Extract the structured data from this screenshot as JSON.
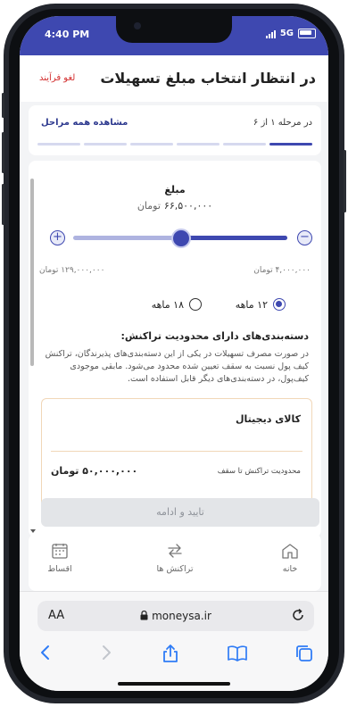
{
  "status_bar": {
    "time": "4:40 PM",
    "network": "5G"
  },
  "header": {
    "title": "در انتظار انتخاب مبلغ تسهیلات",
    "cancel_label": "لغو فرآیند"
  },
  "steps": {
    "current_label": "در مرحله ۱ از ۶",
    "view_all_label": "مشاهده همه مراحل",
    "total": 6,
    "current": 1
  },
  "amount": {
    "label": "مبلغ",
    "value": "۶۶,۵۰۰,۰۰۰",
    "unit": "تومان",
    "min_label": "۴,۰۰۰,۰۰۰ تومان",
    "max_label": "۱۲۹,۰۰۰,۰۰۰ تومان",
    "fraction": 0.5
  },
  "terms": [
    {
      "label": "۱۲ ماهه",
      "selected": true
    },
    {
      "label": "۱۸ ماهه",
      "selected": false
    }
  ],
  "restriction": {
    "title": "دسته‌بندی‌های دارای محدودیت تراکنش:",
    "description": "در صورت مصرف تسهیلات در یکی از این دسته‌بندی‌های پذیرندگان، تراکنش کیف پول نسبت به سقف تعیین شده محدود می‌شود. مابقی موجودی کیف‌پول، در دسته‌بندی‌های دیگر قابل استفاده است.",
    "category": {
      "name": "کالای دیجیتال",
      "limit_label": "محدودیت تراکنش تا سقف",
      "limit_value": "۵۰,۰۰۰,۰۰۰ تومان"
    }
  },
  "confirm_label": "تایید و ادامه",
  "bottom_nav": [
    {
      "label": "خانه",
      "icon": "home-icon"
    },
    {
      "label": "تراکنش ها",
      "icon": "transfer-icon"
    },
    {
      "label": "اقساط",
      "icon": "calendar-icon"
    }
  ],
  "browser": {
    "aa_label": "AA",
    "url": "moneysa.ir"
  },
  "colors": {
    "primary": "#3e48b0",
    "danger": "#d32f2f",
    "accent_border": "#f1d7b8"
  }
}
